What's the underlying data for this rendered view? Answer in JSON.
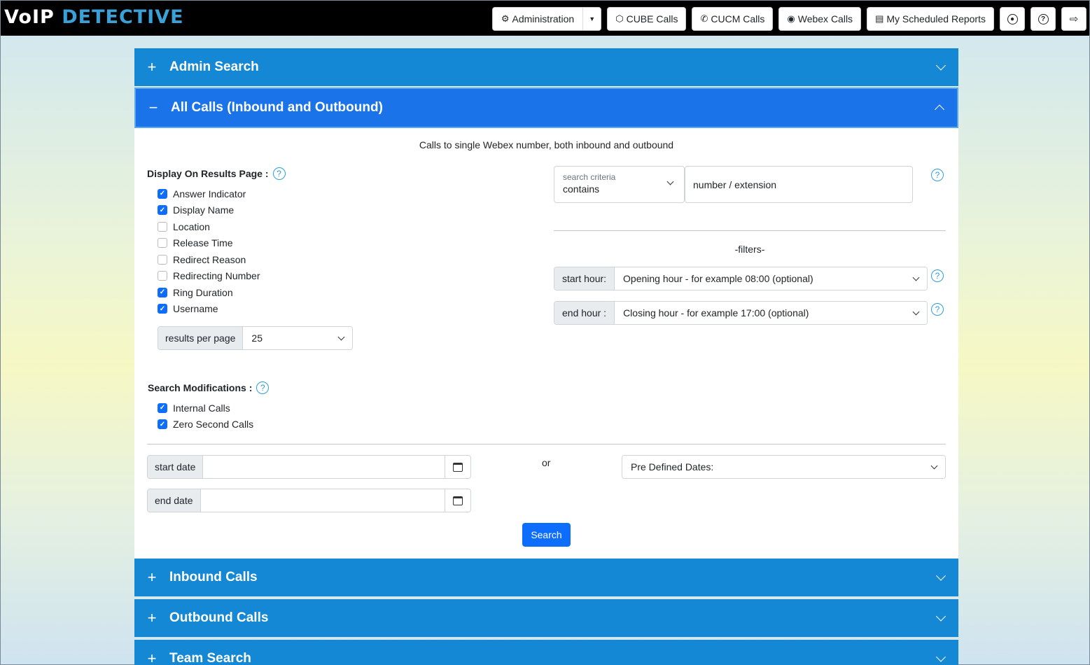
{
  "brand": {
    "part1": "V",
    "part2": "o",
    "part3": "IP",
    "part4": "DETECTIVE"
  },
  "nav": {
    "administration": "Administration",
    "cube_calls": "CUBE Calls",
    "cucm_calls": "CUCM Calls",
    "webex_calls": "Webex Calls",
    "scheduled_reports": "My Scheduled Reports"
  },
  "accordion": {
    "admin_search": "Admin Search",
    "all_calls": "All Calls (Inbound and Outbound)",
    "inbound": "Inbound Calls",
    "outbound": "Outbound Calls",
    "team": "Team Search",
    "plus": "+",
    "minus": "−"
  },
  "form": {
    "description": "Calls to single Webex number, both inbound and outbound",
    "display_label": "Display On Results Page :",
    "display_options": [
      {
        "label": "Answer Indicator",
        "checked": true
      },
      {
        "label": "Display Name",
        "checked": true
      },
      {
        "label": "Location",
        "checked": false
      },
      {
        "label": "Release Time",
        "checked": false
      },
      {
        "label": "Redirect Reason",
        "checked": false
      },
      {
        "label": "Redirecting Number",
        "checked": false
      },
      {
        "label": "Ring Duration",
        "checked": true
      },
      {
        "label": "Username",
        "checked": true
      }
    ],
    "results_per_page_label": "results per page",
    "results_per_page_value": "25",
    "search_mods_label": "Search Modifications :",
    "search_mods": [
      {
        "label": "Internal Calls",
        "checked": true
      },
      {
        "label": "Zero Second Calls",
        "checked": true
      }
    ],
    "criteria_label": "search criteria",
    "criteria_value": "contains",
    "number_placeholder": "number / extension",
    "filters_label": "-filters-",
    "start_hour_label": "start hour:",
    "start_hour_value": "Opening hour - for example 08:00 (optional)",
    "end_hour_label": "end hour :",
    "end_hour_value": "Closing hour - for example 17:00 (optional)",
    "start_date_label": "start date",
    "end_date_label": "end date",
    "or_label": "or",
    "predefined_dates": "Pre Defined Dates:",
    "search_button": "Search",
    "help_glyph": "?"
  },
  "colors": {
    "accordion": "#1488d4",
    "accordion_active": "#1a73e8",
    "primary": "#0d6efd",
    "help": "#2a9fd6"
  }
}
